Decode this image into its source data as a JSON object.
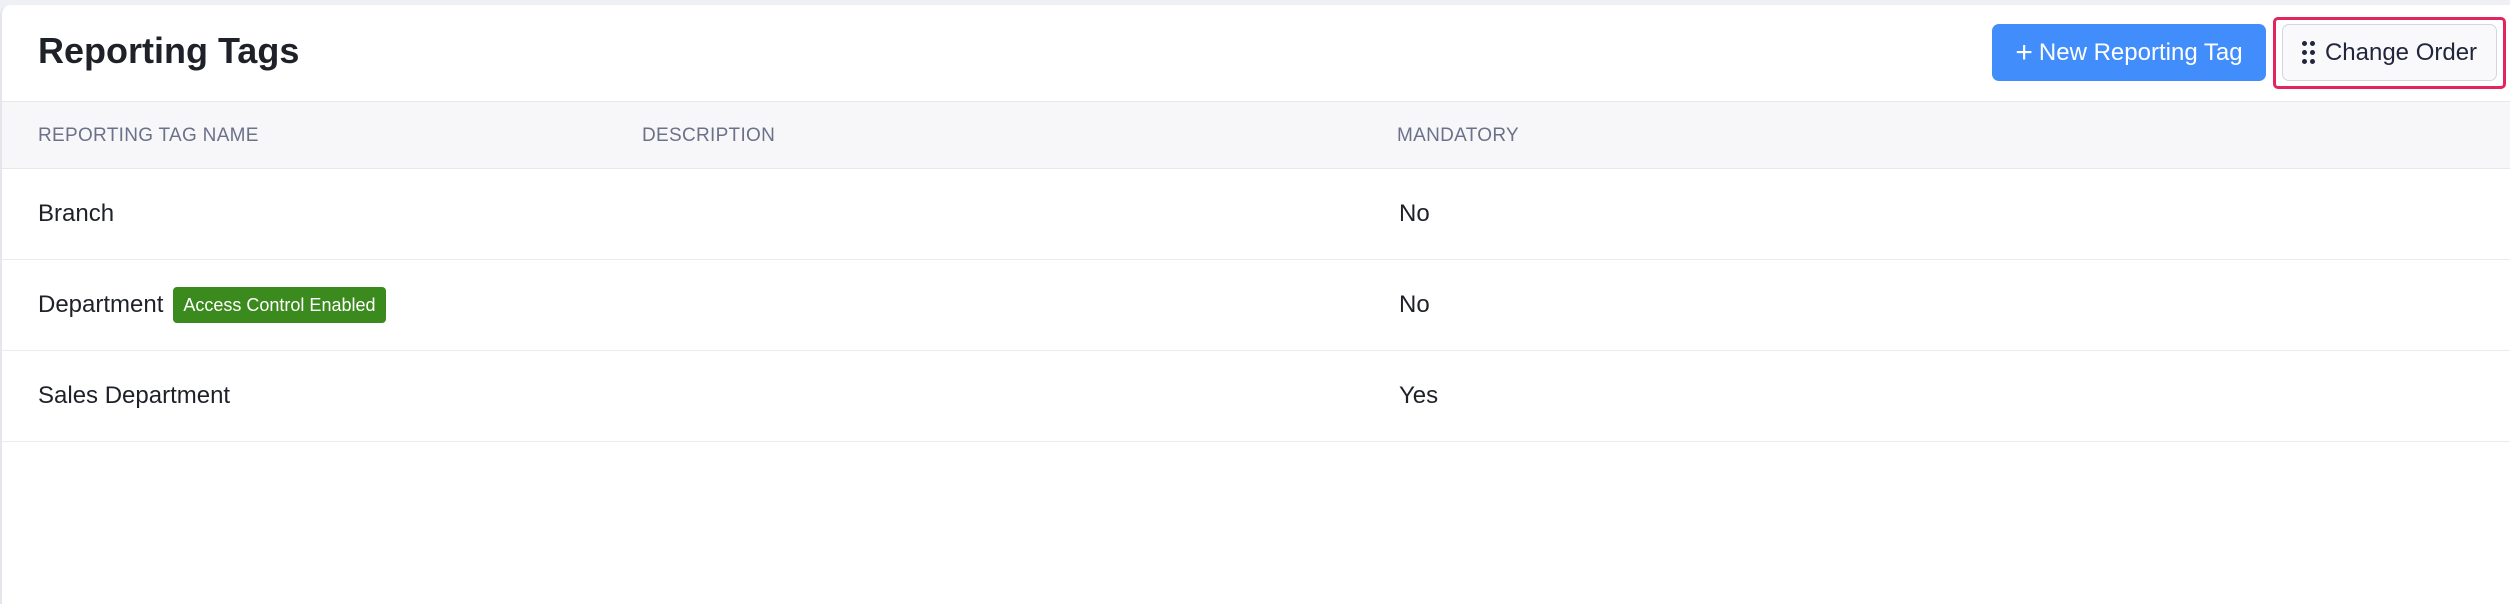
{
  "header": {
    "title": "Reporting Tags",
    "new_button_label": "New Reporting Tag",
    "change_order_label": "Change Order"
  },
  "table": {
    "columns": [
      "REPORTING TAG NAME",
      "DESCRIPTION",
      "MANDATORY"
    ],
    "rows": [
      {
        "name": "Branch",
        "badge": "",
        "description": "",
        "mandatory": "No"
      },
      {
        "name": "Department",
        "badge": "Access Control Enabled",
        "description": "",
        "mandatory": "No"
      },
      {
        "name": "Sales Department",
        "badge": "",
        "description": "",
        "mandatory": "Yes"
      }
    ]
  },
  "colors": {
    "primary": "#408dfb",
    "badge_green": "#3b8a1d",
    "highlight": "#e2255f"
  }
}
